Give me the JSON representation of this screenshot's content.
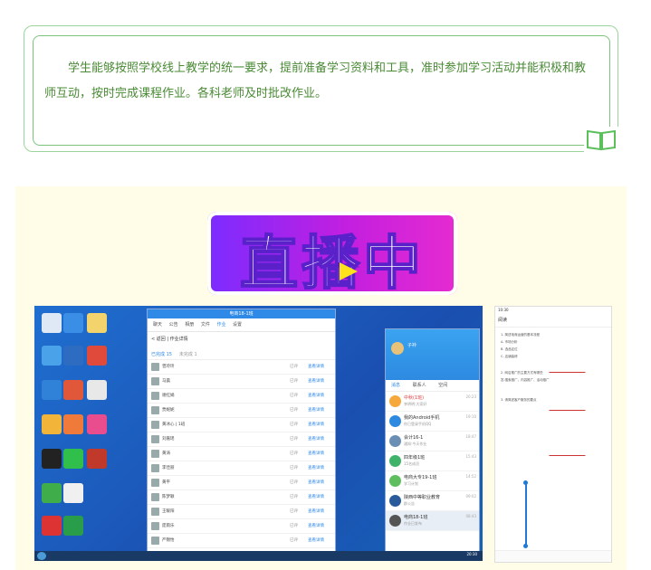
{
  "intro": {
    "text": "学生能够按照学校线上教学的统一要求，提前准备学习资料和工具，准时参加学习活动并能积极和教师互动，按时完成课程作业。各科老师及时批改作业。"
  },
  "live": {
    "title": "直播中"
  },
  "colors": {
    "card_border": "#7cc47c",
    "card_text": "#4a8a35",
    "panel_bg": "#fffde8",
    "live_gradient_start": "#7b2cff",
    "live_gradient_end": "#e62bd0",
    "play_icon": "#ffe21a"
  },
  "desktop": {
    "window_title": "电商18-1班",
    "tabs": [
      "聊天",
      "公告",
      "相册",
      "文件",
      "作业",
      "设置"
    ],
    "breadcrumb": "< 返回  |  作业详情",
    "subtabs": [
      "已完成 15",
      "未完成 1"
    ],
    "rows": [
      {
        "name": "曾玲玲",
        "status": "已评",
        "link": "查看详情"
      },
      {
        "name": "马晨",
        "status": "已评",
        "link": "查看详情"
      },
      {
        "name": "谢红娟",
        "status": "已评",
        "link": "查看详情"
      },
      {
        "name": "贾妮妮",
        "status": "已评",
        "link": "查看详情"
      },
      {
        "name": "黄冰心 | 1班",
        "status": "已评",
        "link": "查看详情"
      },
      {
        "name": "刘嘉瑶",
        "status": "已评",
        "link": "查看详情"
      },
      {
        "name": "黄涛",
        "status": "已评",
        "link": "查看详情"
      },
      {
        "name": "李佳丽",
        "status": "已评",
        "link": "查看详情"
      },
      {
        "name": "黄平",
        "status": "已评",
        "link": "查看详情"
      },
      {
        "name": "陈梦颖",
        "status": "已评",
        "link": "查看详情"
      },
      {
        "name": "王暖阳",
        "status": "已评",
        "link": "查看详情"
      },
      {
        "name": "庞雨乐",
        "status": "已评",
        "link": "查看详情"
      },
      {
        "name": "严锦怡",
        "status": "已评",
        "link": "查看详情"
      }
    ],
    "qq": {
      "name": "子衿",
      "tabs": [
        "消息",
        "联系人",
        "空间"
      ],
      "chats": [
        {
          "name": "中秋(1班)",
          "msg": "李明明:大家好",
          "time": "20:23"
        },
        {
          "name": "我的Android手机",
          "msg": "你已登录手机QQ",
          "time": "19:10"
        },
        {
          "name": "会计16-1",
          "msg": "通知:今天作业",
          "time": "18:47"
        },
        {
          "name": "四年级1班",
          "msg": "15名成员",
          "time": "15:43"
        },
        {
          "name": "电商大专19-1班",
          "msg": "学习计划",
          "time": "14:52"
        },
        {
          "name": "陕西中等职业教育",
          "msg": "群公告",
          "time": "09:02"
        },
        {
          "name": "电商18-1班",
          "msg": "作业已发布",
          "time": "08:43"
        }
      ]
    },
    "clock": "20:30"
  },
  "phone": {
    "status": "10:30",
    "toolbar": "阅读",
    "lines": [
      "1. 简述电商运营的基本流程",
      "A. 市场分析",
      "B. 选品定位",
      "C. 店铺装修",
      "2. 网店推广的主要方式有哪些",
      "答:搜索推广、内容推广、活动推广",
      "3. 请简述客户服务的要点"
    ]
  }
}
